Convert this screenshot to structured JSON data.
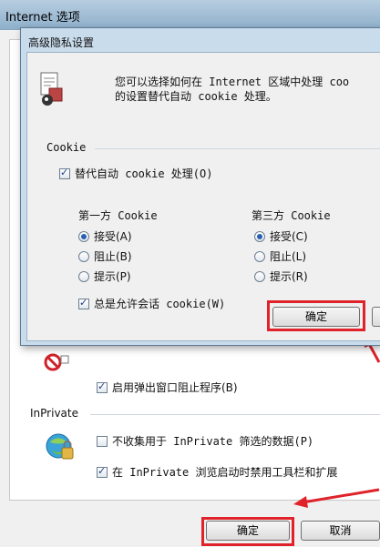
{
  "background_window": {
    "title": "Internet 选项",
    "popup_section": {
      "popup_blocker_label": "启用弹出窗口阻止程序(B)",
      "popup_blocker_checked": true
    },
    "inprivate_section": {
      "heading": "InPrivate",
      "no_collect_label": "不收集用于 InPrivate 筛选的数据(P)",
      "no_collect_checked": false,
      "disable_toolbars_label": "在 InPrivate 浏览启动时禁用工具栏和扩展",
      "disable_toolbars_checked": true
    },
    "footer": {
      "ok_label": "确定",
      "cancel_label": "取消"
    }
  },
  "dialog": {
    "title": "高级隐私设置",
    "description_line1": "您可以选择如何在 Internet 区域中处理 coo",
    "description_line2": "的设置替代自动 cookie 处理。",
    "cookie_group_label": "Cookie",
    "override_label": "替代自动 cookie 处理(O)",
    "override_checked": true,
    "first_party": {
      "heading": "第一方 Cookie",
      "options": [
        {
          "label": "接受(A)",
          "selected": true
        },
        {
          "label": "阻止(B)",
          "selected": false
        },
        {
          "label": "提示(P)",
          "selected": false
        }
      ]
    },
    "third_party": {
      "heading": "第三方 Cookie",
      "options": [
        {
          "label": "接受(C)",
          "selected": true
        },
        {
          "label": "阻止(L)",
          "selected": false
        },
        {
          "label": "提示(R)",
          "selected": false
        }
      ]
    },
    "session_cookie_label": "总是允许会话 cookie(W)",
    "session_cookie_checked": true,
    "ok_label": "确定"
  },
  "colors": {
    "highlight": "#e0222a",
    "dialog_frame": "#c9dcec",
    "radio_dot": "#2a5fb5"
  }
}
